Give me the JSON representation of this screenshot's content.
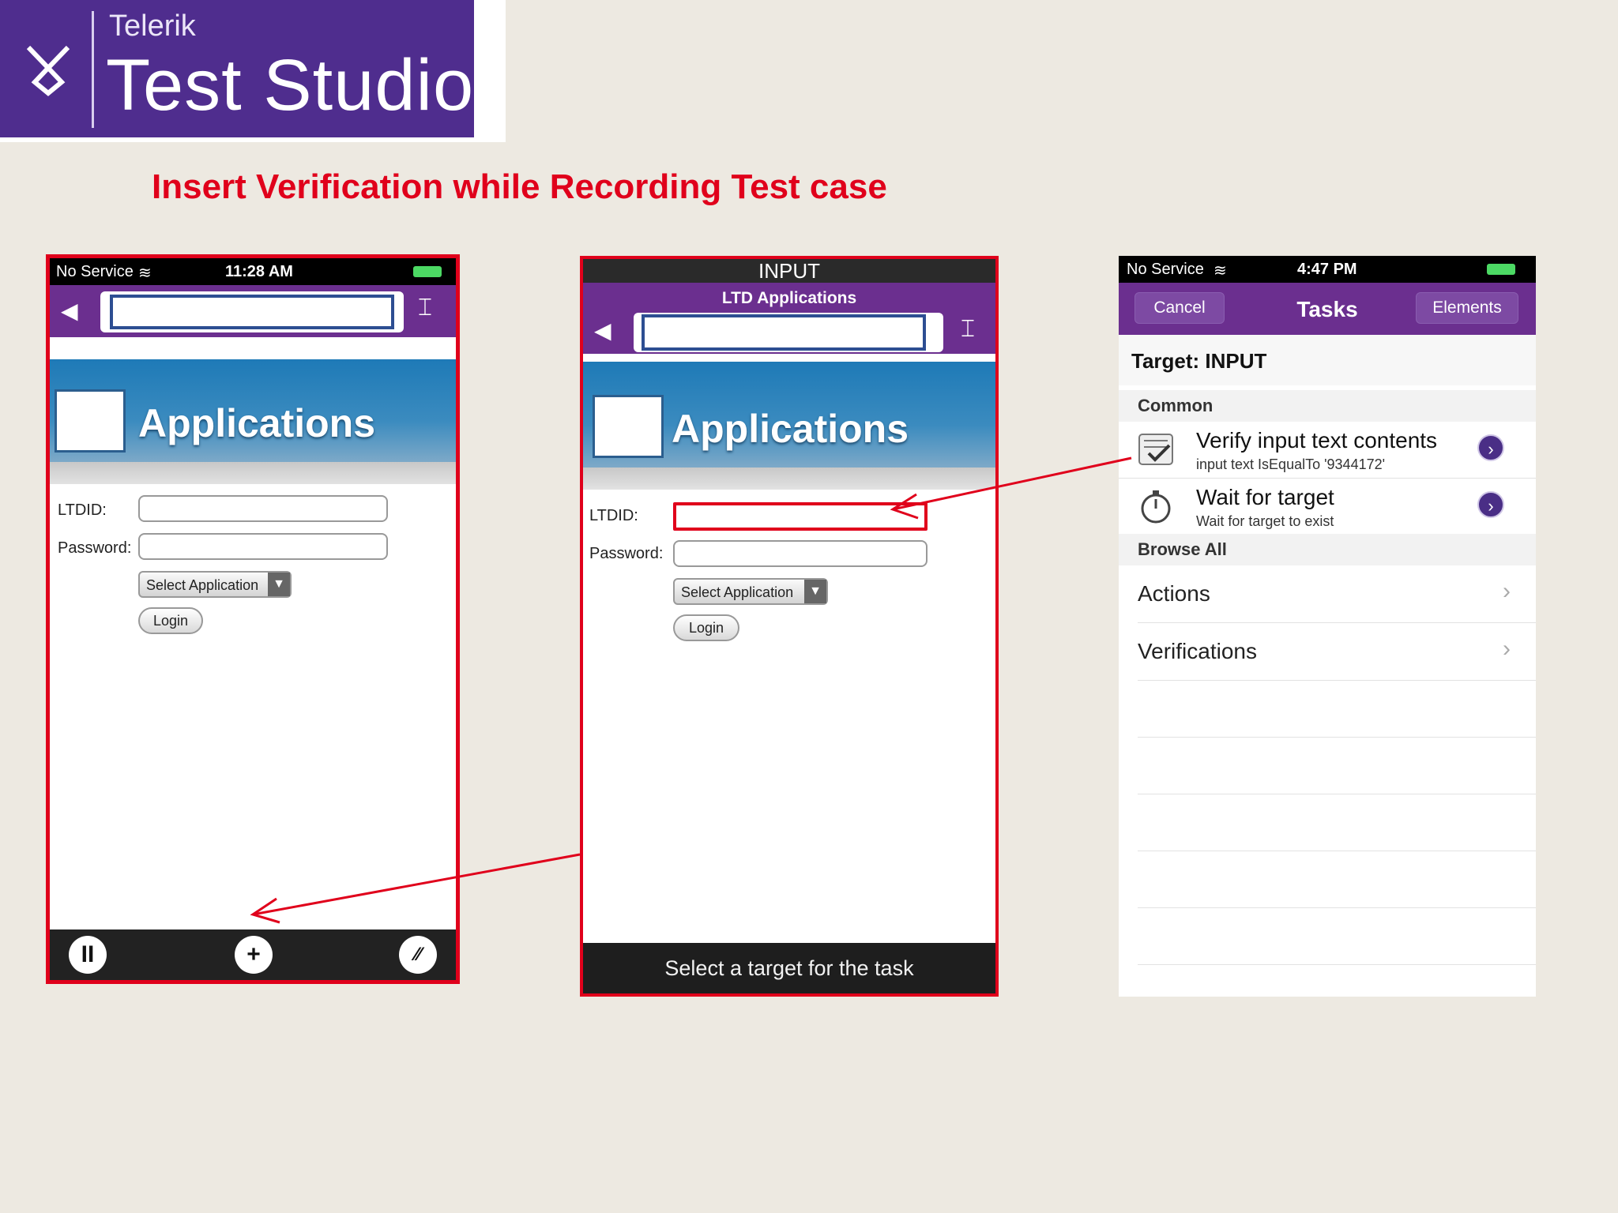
{
  "logo": {
    "brand": "Telerik",
    "product": "Test Studio"
  },
  "slide_title": "Insert Verification while Recording Test case",
  "phone1": {
    "status": {
      "carrier": "No Service",
      "time": "11:28 AM"
    },
    "banner_title": "Applications",
    "form": {
      "id_label": "LTDID:",
      "password_label": "Password:",
      "select_label": "Select Application",
      "login_label": "Login"
    }
  },
  "phone2": {
    "header": "INPUT",
    "page_title": "LTD Applications",
    "banner_title": "Applications",
    "form": {
      "id_label": "LTDID:",
      "password_label": "Password:",
      "select_label": "Select Application",
      "login_label": "Login"
    },
    "footer": "Select a target for the task"
  },
  "phone3": {
    "status": {
      "carrier": "No Service",
      "time": "4:47 PM"
    },
    "nav": {
      "cancel": "Cancel",
      "title": "Tasks",
      "elements": "Elements"
    },
    "target": "Target: INPUT",
    "common_header": "Common",
    "tasks": [
      {
        "title": "Verify input text contents",
        "subtitle": "input text IsEqualTo '9344172'"
      },
      {
        "title": "Wait for target",
        "subtitle": "Wait for target to exist"
      }
    ],
    "browse_header": "Browse All",
    "browse": [
      "Actions",
      "Verifications"
    ]
  },
  "colors": {
    "accent_red": "#e0001b",
    "purple": "#6b2f8f",
    "logo_purple": "#4f2d8e"
  }
}
